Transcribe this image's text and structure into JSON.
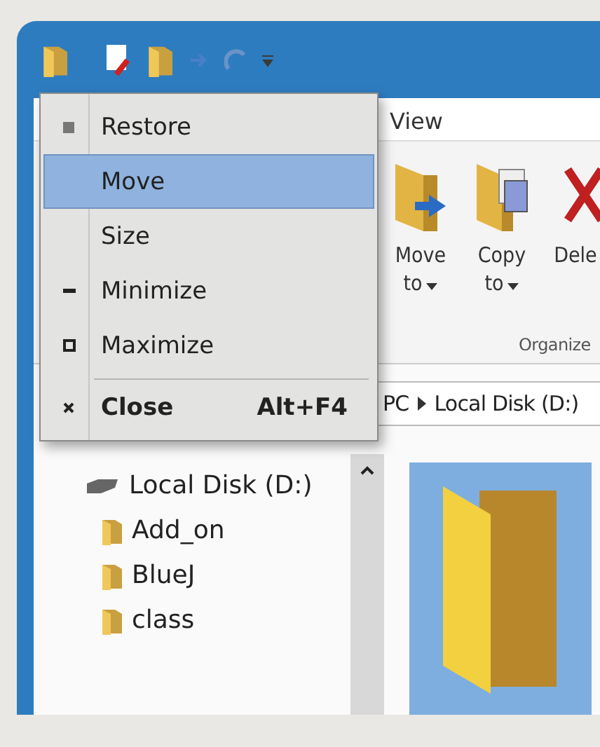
{
  "menu": {
    "items": [
      {
        "kind": "restore",
        "label": "Restore",
        "selected": false
      },
      {
        "kind": "move",
        "label": "Move",
        "selected": true
      },
      {
        "kind": "size",
        "label": "Size",
        "selected": false
      },
      {
        "kind": "minimize",
        "label": "Minimize",
        "selected": false
      },
      {
        "kind": "maximize",
        "label": "Maximize",
        "selected": false
      },
      {
        "kind": "close",
        "label": "Close",
        "shortcut": "Alt+F4",
        "selected": false,
        "separator_before": true
      }
    ]
  },
  "ribbon": {
    "tabs": [
      {
        "label": "View",
        "selected": false
      }
    ],
    "buttons": [
      {
        "kind": "move",
        "label": "Move to"
      },
      {
        "kind": "copy",
        "label": "Copy to"
      },
      {
        "kind": "delete",
        "label": "Dele"
      }
    ],
    "group": "Organize"
  },
  "address": {
    "crumbs": [
      "PC",
      "Local Disk (D:)"
    ]
  },
  "nav": {
    "items": [
      {
        "kind": "drive",
        "label": "Local Disk (D:)"
      },
      {
        "kind": "folder",
        "label": "Add_on"
      },
      {
        "kind": "folder",
        "label": "BlueJ"
      },
      {
        "kind": "folder",
        "label": "class"
      }
    ]
  },
  "content": {
    "tiles": [
      {
        "kind": "folder",
        "selected": true
      }
    ]
  }
}
